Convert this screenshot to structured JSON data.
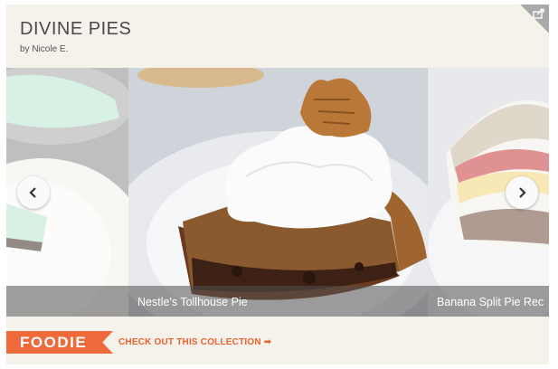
{
  "collection": {
    "title": "DIVINE PIES",
    "byline": "by Nicole E."
  },
  "carousel": {
    "slides": [
      {
        "caption": ""
      },
      {
        "caption": "Nestle's Tollhouse Pie"
      },
      {
        "caption": "Banana Split Pie Rec"
      }
    ]
  },
  "footer": {
    "badge": "FOODIE",
    "cta_label": "CHECK OUT THIS COLLECTION",
    "cta_arrow": "➡"
  },
  "colors": {
    "accent": "#ee6a3a",
    "card_bg": "#f5f1eb"
  },
  "icons": {
    "share": "share-icon",
    "prev": "chevron-left-icon",
    "next": "chevron-right-icon"
  }
}
